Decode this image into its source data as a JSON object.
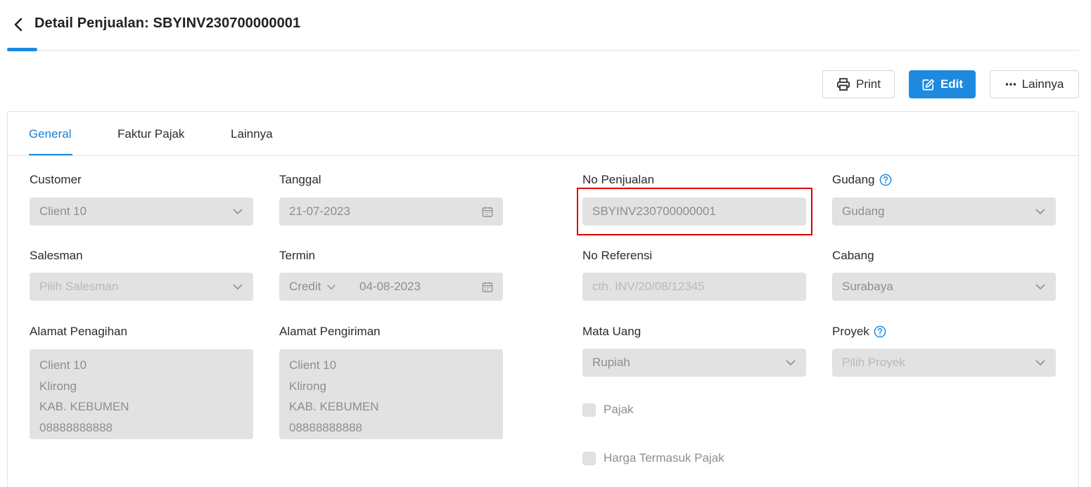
{
  "header": {
    "title": "Detail Penjualan: SBYINV230700000001"
  },
  "toolbar": {
    "print_label": "Print",
    "edit_label": "Edit",
    "more_label": "Lainnya"
  },
  "tabs": [
    {
      "label": "General",
      "active": true
    },
    {
      "label": "Faktur Pajak",
      "active": false
    },
    {
      "label": "Lainnya",
      "active": false
    }
  ],
  "form": {
    "customer": {
      "label": "Customer",
      "value": "Client 10"
    },
    "tanggal": {
      "label": "Tanggal",
      "value": "21-07-2023"
    },
    "no_penjualan": {
      "label": "No Penjualan",
      "value": "SBYINV230700000001"
    },
    "gudang": {
      "label": "Gudang",
      "value": "Gudang"
    },
    "salesman": {
      "label": "Salesman",
      "placeholder": "Pilih Salesman"
    },
    "termin": {
      "label": "Termin",
      "type": "Credit",
      "date": "04-08-2023"
    },
    "no_referensi": {
      "label": "No Referensi",
      "placeholder": "cth. INV/20/08/12345"
    },
    "cabang": {
      "label": "Cabang",
      "value": "Surabaya"
    },
    "alamat_penagihan": {
      "label": "Alamat Penagihan",
      "lines": [
        "Client 10",
        "Klirong",
        "KAB. KEBUMEN",
        "08888888888"
      ]
    },
    "alamat_pengiriman": {
      "label": "Alamat Pengiriman",
      "lines": [
        "Client 10",
        "Klirong",
        "KAB. KEBUMEN",
        "08888888888"
      ]
    },
    "mata_uang": {
      "label": "Mata Uang",
      "value": "Rupiah"
    },
    "proyek": {
      "label": "Proyek",
      "placeholder": "Pilih Proyek"
    },
    "pajak": {
      "label": "Pajak",
      "checked": false
    },
    "harga_termasuk_pajak": {
      "label": "Harga Termasuk Pajak",
      "checked": false
    }
  },
  "colors": {
    "primary": "#1d8ae0",
    "highlight": "#e00000",
    "field_bg": "#e2e2e2"
  }
}
